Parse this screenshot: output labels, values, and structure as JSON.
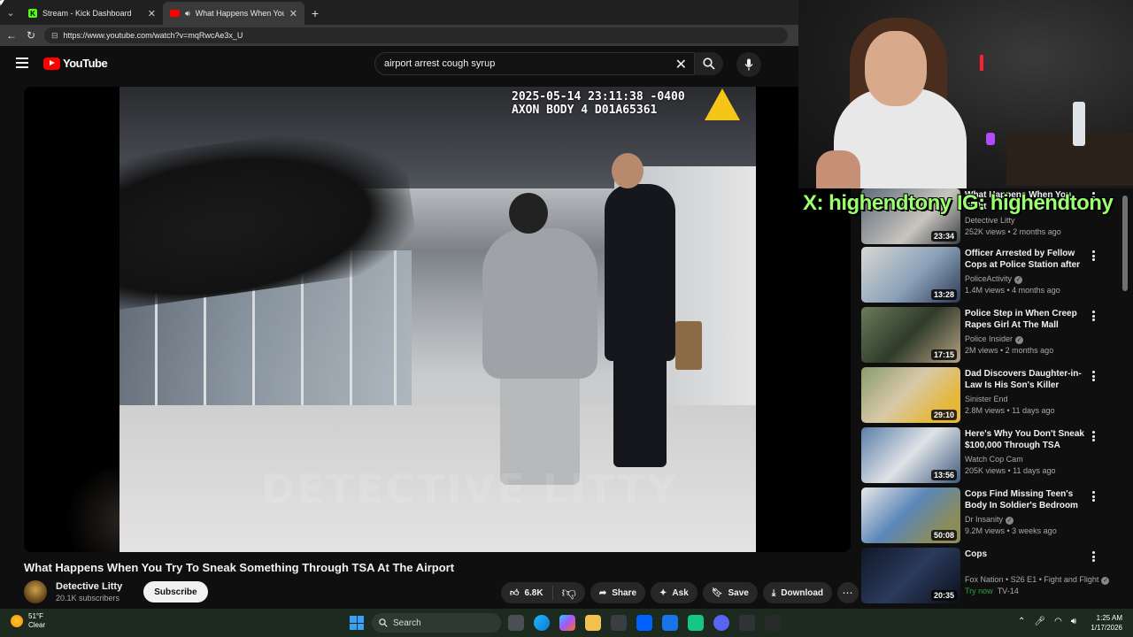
{
  "browser": {
    "tabs": [
      {
        "title": "Stream - Kick Dashboard",
        "icon": "kick-icon",
        "active": false
      },
      {
        "title": "What Happens When You Try",
        "icon": "youtube-icon",
        "active": true
      }
    ],
    "url": "https://www.youtube.com/watch?v=mqRwcAe3x_U"
  },
  "youtube": {
    "logo_text": "YouTube",
    "search_query": "airport arrest cough syrup"
  },
  "video": {
    "title": "What Happens When You Try To Sneak Something Through TSA At The Airport",
    "overlay_timestamp": "2025-05-14 23:11:38 -0400",
    "overlay_device": "AXON BODY 4 D01A65361",
    "watermark": "DETECTIVE LITTY",
    "channel": "Detective Litty",
    "subscribers": "20.1K subscribers",
    "subscribe_label": "Subscribe",
    "likes": "6.8K",
    "share_label": "Share",
    "ask_label": "Ask",
    "save_label": "Save",
    "download_label": "Download"
  },
  "stream_overlay": {
    "text": "X: highendtony IG: highendtony",
    "color": "#9cff6f"
  },
  "recommendations": [
    {
      "title": "What Happens When You Fight",
      "channel": "Detective Litty",
      "meta": "252K views • 2 months ago",
      "duration": "23:34",
      "verified": false
    },
    {
      "title": "Officer Arrested by Fellow Cops at Police Station after ...",
      "channel": "PoliceActivity",
      "meta": "1.4M views • 4 months ago",
      "duration": "13:28",
      "verified": true
    },
    {
      "title": "Police Step in When Creep Rapes Girl At The Mall",
      "channel": "Police Insider",
      "meta": "2M views • 2 months ago",
      "duration": "17:15",
      "verified": true
    },
    {
      "title": "Dad Discovers Daughter-in-Law Is His Son's Killer",
      "channel": "Sinister End",
      "meta": "2.8M views • 11 days ago",
      "duration": "29:10",
      "verified": false
    },
    {
      "title": "Here's Why You Don't Sneak $100,000 Through TSA",
      "channel": "Watch Cop Cam",
      "meta": "205K views • 11 days ago",
      "duration": "13:56",
      "verified": false
    },
    {
      "title": "Cops Find Missing Teen's Body In Soldier's Bedroom",
      "channel": "Dr Insanity",
      "meta": "9.2M views • 3 weeks ago",
      "duration": "50:08",
      "verified": true
    },
    {
      "title": "Cops",
      "channel": "Fox Nation • S26 E1 • Fight and Flight",
      "meta_try": "Try now",
      "meta_rating": "TV-14",
      "duration": "20:35",
      "verified": true
    }
  ],
  "taskbar": {
    "weather_temp": "51°F",
    "weather_desc": "Clear",
    "search_label": "Search",
    "time": "1:25 AM",
    "date": "1/17/2026"
  }
}
